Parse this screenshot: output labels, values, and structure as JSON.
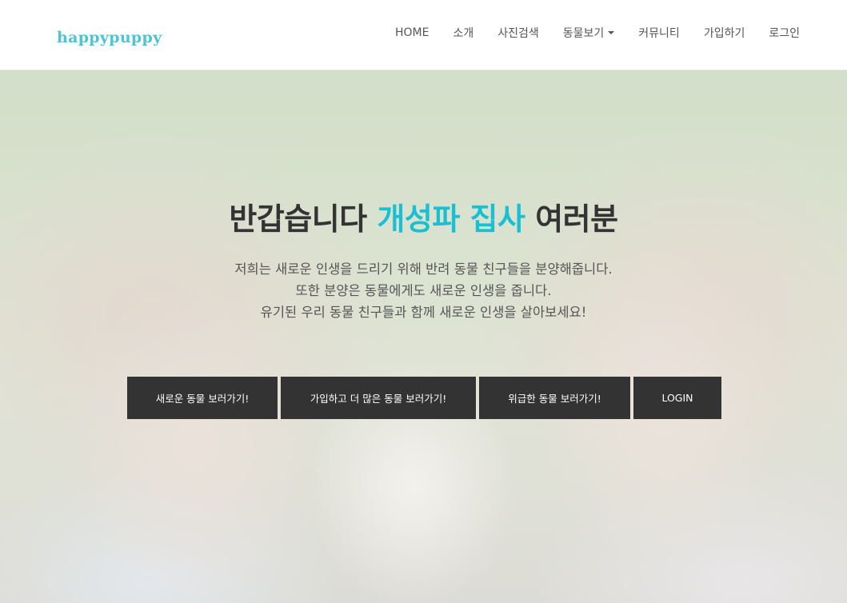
{
  "navbar": {
    "logo": "happypuppy",
    "items": [
      {
        "label": "HOME"
      },
      {
        "label": "소개"
      },
      {
        "label": "사진검색"
      },
      {
        "label": "동물보기"
      },
      {
        "label": "커뮤니티"
      },
      {
        "label": "가입하기"
      },
      {
        "label": "로그인"
      }
    ]
  },
  "hero": {
    "title_prefix": "반갑습니다",
    "title_accent": "개성파 집사",
    "title_suffix": "여러분",
    "lines": [
      "저희는 새로운 인생을 드리기 위해 반려 동물 친구들을 분양해줍니다.",
      "또한 분양은 동물에게도 새로운 인생을 줍니다.",
      "유기된 우리 동물 친구들과 함께 새로운 인생을 살아보세요!"
    ],
    "buttons": [
      {
        "label": "새로운 동물 보러가기!"
      },
      {
        "label": "가입하고 더 많은 동물 보러가기!"
      },
      {
        "label": "위급한 동물 보러가기!"
      },
      {
        "label": "LOGIN"
      }
    ]
  },
  "colors": {
    "accent": "#19bfd2",
    "logo": "#4cc4d4",
    "button_bg": "#333333",
    "title_text": "#333333"
  },
  "icons": {
    "dropdown": "caret-down-icon",
    "hero_background": "children-and-puppy-photo"
  }
}
